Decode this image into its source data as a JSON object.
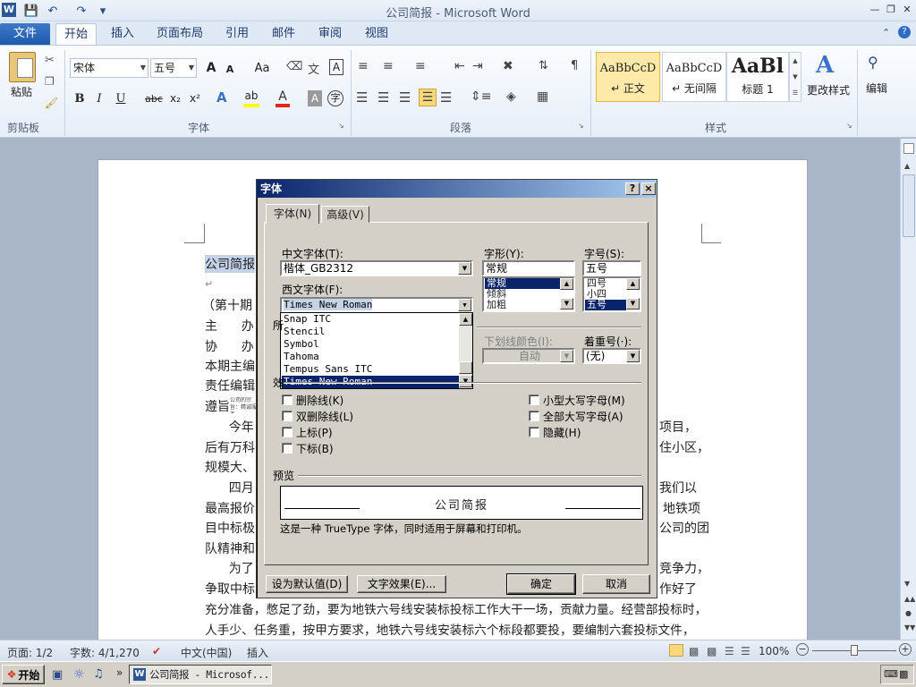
{
  "window": {
    "title": "公司简报  -  Microsoft Word"
  },
  "ribbon": {
    "file_tab": "文件",
    "tabs": [
      "开始",
      "插入",
      "页面布局",
      "引用",
      "邮件",
      "审阅",
      "视图"
    ],
    "clipboard": {
      "paste": "粘贴",
      "label": "剪贴板"
    },
    "font": {
      "name": "宋体",
      "size": "五号",
      "label": "字体",
      "grow": "A",
      "shrink": "A",
      "aa": "Aa",
      "bold": "B",
      "italic": "I",
      "underline": "U",
      "strike": "abc",
      "sub": "x₂",
      "sup": "x²",
      "char_border": "A"
    },
    "paragraph": {
      "label": "段落"
    },
    "styles": {
      "label": "样式",
      "items": [
        {
          "preview": "AaBbCcD",
          "name": "↵ 正文"
        },
        {
          "preview": "AaBbCcD",
          "name": "↵ 无间隔"
        },
        {
          "preview": "AaBl",
          "name": "标题 1"
        }
      ],
      "change": "更改样式"
    },
    "editing": {
      "label": "编辑"
    }
  },
  "document": {
    "lines": [
      {
        "text": "公司简报",
        "highlight": true
      },
      {
        "text": "↵"
      },
      {
        "text": "（第十期"
      },
      {
        "text": "主      办"
      },
      {
        "text": "协      办"
      },
      {
        "text": "本期主编"
      },
      {
        "text": "责任编辑"
      },
      {
        "text": "遵旨"
      },
      {
        "text": "      今年"
      },
      {
        "text": "后有万科"
      },
      {
        "text": "规模大、"
      },
      {
        "text": "      四月"
      },
      {
        "text": "最高报价"
      },
      {
        "text": "目中标极"
      },
      {
        "text": "队精神和"
      },
      {
        "text": "      为了"
      },
      {
        "text": "争取中标"
      },
      {
        "text": "充分准备，憋足了劲，要为地铁六号线安装标投标工作大干一场，贡献力量。经营部投标时，"
      },
      {
        "text": "人手少、任务重，按甲方要求，地铁六号线安装标六个标段都要投，要编制六套投标文件，"
      }
    ],
    "right_fragments": [
      "项目，",
      "住小区，",
      "我们以",
      "地铁项",
      "公司的团",
      "竞争力，",
      "作好了"
    ],
    "zhuzhi_small": "公司的宗旨：精诚服务",
    "dialog_stray": [
      "所",
      "效"
    ]
  },
  "dialog": {
    "title": "字体",
    "help_btn": "?",
    "close_btn": "×",
    "tabs": [
      "字体(N)",
      "高级(V)"
    ],
    "cn_font_label": "中文字体(T):",
    "cn_font_value": "楷体_GB2312",
    "west_font_label": "西文字体(F):",
    "west_font_value": "Times New Roman",
    "font_list": [
      "Snap ITC",
      "Stencil",
      "Symbol",
      "Tahoma",
      "Tempus Sans ITC",
      "Times New Roman"
    ],
    "style_label": "字形(Y):",
    "style_value": "常规",
    "style_list": [
      "常规",
      "倾斜",
      "加粗"
    ],
    "size_label": "字号(S):",
    "size_value": "五号",
    "size_list": [
      "四号",
      "小四",
      "五号"
    ],
    "underline_color_label": "下划线颜色(I):",
    "underline_color_value": "自动",
    "emphasis_label": "着重号(·):",
    "emphasis_value": "(无)",
    "effects": {
      "left": [
        "删除线(K)",
        "双删除线(L)",
        "上标(P)",
        "下标(B)"
      ],
      "right": [
        "小型大写字母(M)",
        "全部大写字母(A)",
        "隐藏(H)"
      ]
    },
    "preview_label": "预览",
    "preview_text": "公司简报",
    "preview_note": "这是一种 TrueType 字体，同时适用于屏幕和打印机。",
    "buttons": {
      "default": "设为默认值(D)",
      "text_effects": "文字效果(E)...",
      "ok": "确定",
      "cancel": "取消"
    }
  },
  "status": {
    "page": "页面: 1/2",
    "words": "字数: 4/1,270",
    "lang": "中文(中国)",
    "mode": "插入",
    "zoom": "100%"
  },
  "taskbar": {
    "start": "开始",
    "task": "公司简报 - Microsof..."
  }
}
